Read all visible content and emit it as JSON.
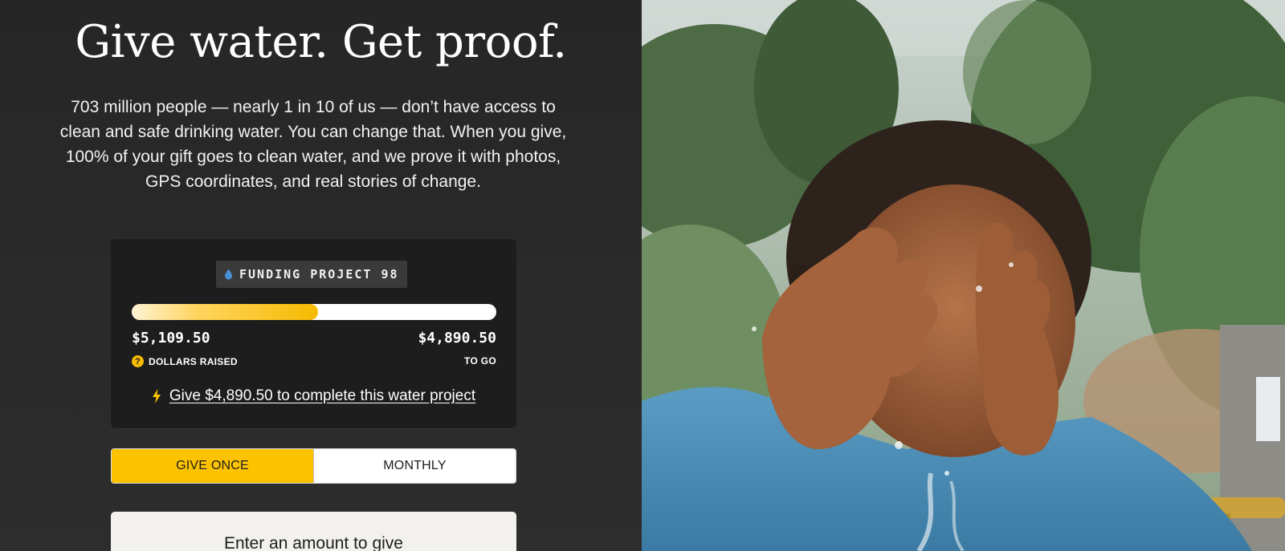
{
  "hero": {
    "headline": "Give water. Get proof.",
    "intro": "703 million people — nearly 1 in 10 of us — don’t have access to clean and safe drinking water. You can change that. When you give, 100% of your gift goes to clean water, and we prove it with photos, GPS coordinates, and real stories of change."
  },
  "funding": {
    "badge_icon": "water-drop-icon",
    "badge_label": "FUNDING PROJECT 98",
    "progress_fraction": 0.511,
    "raised_amount": "$5,109.50",
    "raised_label": "DOLLARS RAISED",
    "info_icon": "question-icon",
    "togo_amount": "$4,890.50",
    "togo_label": "TO GO",
    "complete_icon": "lightning-icon",
    "complete_link": "Give $4,890.50 to complete this water project"
  },
  "frequency": {
    "once_label": "GIVE ONCE",
    "monthly_label": "MONTHLY",
    "selected": "once"
  },
  "amount": {
    "label": "Enter an amount to give"
  },
  "colors": {
    "accent": "#fdc300",
    "panel": "#262626",
    "card": "#1d1d1d",
    "drop": "#4a90d9"
  }
}
